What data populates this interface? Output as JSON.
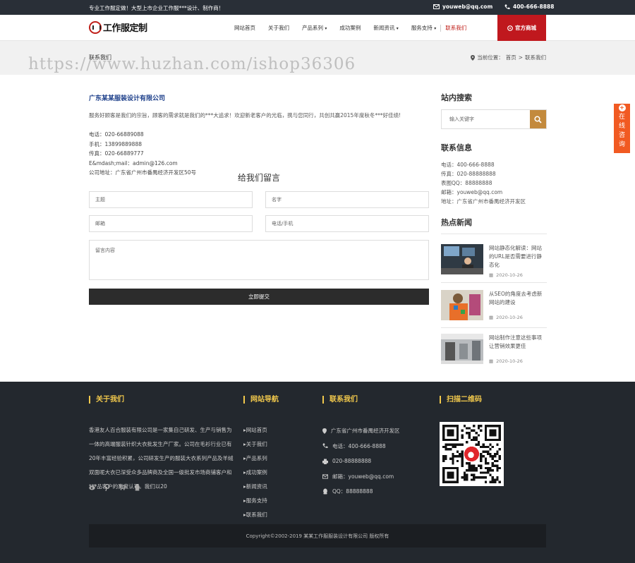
{
  "topbar": {
    "message": "专业工作服定做！大型上市企业工作服***设计、制作商！",
    "email": "youweb@qq.com",
    "phone": "400-666-8888"
  },
  "logo": {
    "text": "工作服定制"
  },
  "nav": {
    "items": [
      {
        "label": "网站首页",
        "dropdown": false
      },
      {
        "label": "关于我们",
        "dropdown": false
      },
      {
        "label": "产品系列",
        "dropdown": true
      },
      {
        "label": "成功案例",
        "dropdown": false
      },
      {
        "label": "新闻资讯",
        "dropdown": true
      },
      {
        "label": "服务支持",
        "dropdown": true
      },
      {
        "label": "联系我们",
        "dropdown": false
      }
    ],
    "button": "官方商城"
  },
  "banner": {
    "title": "联系我们",
    "crumb_prefix": "当前位置：",
    "crumb_home": "首页",
    "crumb_sep": " > ",
    "crumb_current": "联系我们"
  },
  "watermark": "https://www.huzhan.com/ishop36306",
  "contact": {
    "company": "广东某某服装设计有限公司",
    "intro": "服务好顾客是我们的宗旨，顾客的需求就是我们的***大追求！欢迎新老客户的光临，携与您同行，共创共赢2015年度秋冬***好佳绩!",
    "lines": [
      "电话：020-66889088",
      "手机：13899889888",
      "传真：020-66889777",
      "E&mdash;mail：admin@126.com",
      "公司地址：广东省广州市番禺经济开发区50号"
    ]
  },
  "form": {
    "title": "给我们留言",
    "subject_placeholder": "主题",
    "name_placeholder": "名字",
    "email_placeholder": "邮箱",
    "phone_placeholder": "电话/手机",
    "message_placeholder": "留言内容",
    "submit": "立即提交"
  },
  "sidebar": {
    "search_title": "站内搜索",
    "search_placeholder": "输入关键字",
    "info_title": "联系信息",
    "info_lines": [
      "电话：400-666-8888",
      "传真：020-88888888",
      "表图QQ：88888888",
      "邮箱：youweb@qq.com",
      "地址：广东省广州市番禺经济开发区"
    ],
    "news_title": "热点新闻",
    "news": [
      {
        "title": "网站静态化解读：网站的URL是否需要进行静态化",
        "date": "2020-10-26"
      },
      {
        "title": "从SEO的角度去考虑新网站的建设",
        "date": "2020-10-26"
      },
      {
        "title": "网站制作注意这些事项让营销效果更佳",
        "date": "2020-10-26"
      }
    ]
  },
  "float": {
    "label": [
      "在",
      "线",
      "咨",
      "询"
    ]
  },
  "footer": {
    "about_title": "关于我们",
    "about_text": "香港友人百合服装有限公司是一家集自己研发、生产与销售为一体的高端服装针织大衣批发生产厂家。公司在毛衫行业已有20年丰富经验积累，公司研发生产的服装大衣系列产品及羊绒双面呢大衣已深受众多品牌商及全国一级批发市场商铺客户和***品客户的高度认可。我们以20",
    "nav_title": "网站导航",
    "nav_items": [
      "网站首页",
      "关于我们",
      "产品系列",
      "成功案例",
      "新闻资讯",
      "服务支持",
      "联系我们"
    ],
    "contact_title": "联系我们",
    "contact_lines": [
      {
        "icon": "location-icon",
        "text": "广东省广州市番禺经济开发区"
      },
      {
        "icon": "phone-icon",
        "text": "电话：400-666-8888"
      },
      {
        "icon": "printer-icon",
        "text": "020-88888888"
      },
      {
        "icon": "envelope-icon",
        "text": "邮箱：youweb@qq.com"
      },
      {
        "icon": "qq-icon",
        "text": "QQ：88888888"
      }
    ],
    "qr_title": "扫描二维码",
    "copyright": "Copyright©2002-2019 某某工作服服装设计有限公司 版权所有"
  },
  "colors": {
    "topbar_bg": "#292f37",
    "brand_red": "#c0181e",
    "link_blue": "#1d3f8a",
    "search_btn": "#c38a3d",
    "float_orange": "#f15a22",
    "footer_bg": "#23282e",
    "footer_heading": "#f2c94c"
  }
}
